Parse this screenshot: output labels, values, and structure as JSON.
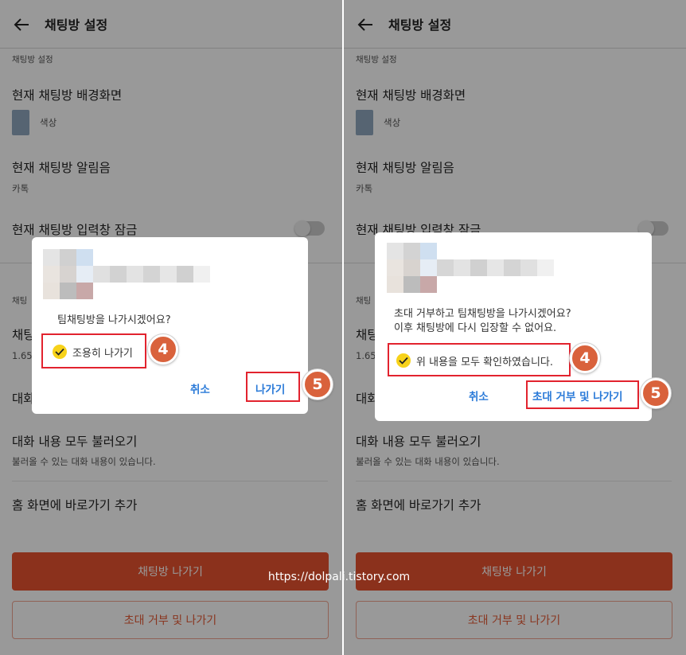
{
  "panels": {
    "left": {
      "header_title": "채팅방 설정",
      "section_label": "채팅방 설정",
      "background_title": "현재 채팅방 배경화면",
      "background_value": "색상",
      "notification_title": "현재 채팅방 알림음",
      "notification_value": "카톡",
      "input_lock_title": "현재 채팅방 입력창 잠금",
      "section2_label_partial": "채팅",
      "row_partial_title": "채팅",
      "row_partial_sub": "1.65",
      "row_partial2_title": "대화",
      "load_title": "대화 내용 모두 불러오기",
      "load_sub": "불러올 수 있는 대화 내용이 있습니다.",
      "shortcut_title": "홈 화면에 바로가기 추가",
      "leave_button": "채팅방 나가기",
      "decline_button": "초대 거부 및 나가기",
      "dialog": {
        "message": "팀채팅방을 나가시겠어요?",
        "checkbox_label": "조용히 나가기",
        "cancel": "취소",
        "confirm": "나가기",
        "step_check": "4",
        "step_confirm": "5"
      }
    },
    "right": {
      "header_title": "채팅방 설정",
      "section_label": "채팅방 설정",
      "background_title": "현재 채팅방 배경화면",
      "background_value": "색상",
      "notification_title": "현재 채팅방 알림음",
      "notification_value": "카톡",
      "input_lock_title": "현재 채팅방 입력창 잠금",
      "section2_label_partial": "채팅",
      "row_partial_title": "채팅",
      "row_partial_sub": "1.65",
      "row_partial2_title": "대화",
      "load_title": "대화 내용 모두 불러오기",
      "load_sub": "불러올 수 있는 대화 내용이 있습니다.",
      "shortcut_title": "홈 화면에 바로가기 추가",
      "leave_button": "채팅방 나가기",
      "decline_button": "초대 거부 및 나가기",
      "dialog": {
        "message_line1": "초대 거부하고 팀채팅방을 나가시겠어요?",
        "message_line2": "이후 채팅방에 다시 입장할 수 없어요.",
        "checkbox_label": "위 내용을 모두 확인하였습니다.",
        "cancel": "취소",
        "confirm": "초대 거부 및 나가기",
        "step_check": "4",
        "step_confirm": "5"
      }
    }
  },
  "watermark": "https://dolpali.tistory.com",
  "colors": {
    "accent_orange": "#e8532f",
    "badge": "#d9623c",
    "highlight_red": "#e2232e",
    "dialog_button_blue": "#2a7ad8",
    "check_yellow": "#f7d21a"
  }
}
